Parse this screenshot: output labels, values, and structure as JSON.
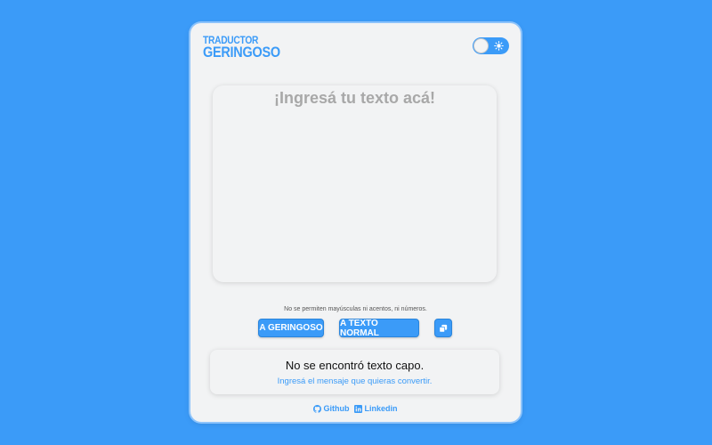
{
  "header": {
    "logo_line1": "TRADUCTOR",
    "logo_line2": "GERINGOSO"
  },
  "theme_toggle": {
    "state": "light",
    "icon": "sun-icon"
  },
  "input": {
    "placeholder": "¡Ingresá tu texto acá!",
    "value": ""
  },
  "notice": "No se permiten mayúsculas ni acentos, ni números.",
  "buttons": {
    "to_geringoso": "A GERINGOSO",
    "to_normal": "A TEXTO NORMAL",
    "copy_icon": "copy-icon"
  },
  "result": {
    "title": "No se encontró texto capo.",
    "subtitle": "Ingresá el mensaje que quieras convertir."
  },
  "footer": {
    "github_label": "Github",
    "linkedin_label": "Linkedin"
  },
  "colors": {
    "accent": "#3b9bf8",
    "card_bg": "#f2f3f4",
    "placeholder": "#a8a8a8"
  }
}
